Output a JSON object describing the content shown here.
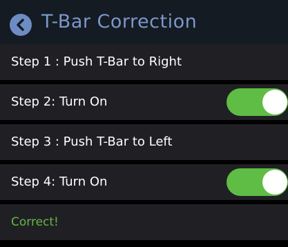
{
  "header": {
    "title": "T-Bar Correction",
    "back_icon": "chevron-left-icon",
    "accent_color": "#7c97cc"
  },
  "steps": [
    {
      "label": "Step 1 : Push T-Bar to Right"
    },
    {
      "label": "Step 2: Turn On",
      "toggle_on": true
    },
    {
      "label": "Step 3 : Push T-Bar to Left"
    },
    {
      "label": "Step 4: Turn On",
      "toggle_on": true
    }
  ],
  "status": {
    "text": "Correct!",
    "color": "#62b846"
  },
  "colors": {
    "toggle_on": "#5fbd45",
    "row_background": "#202024",
    "header_background": "#141b22"
  }
}
